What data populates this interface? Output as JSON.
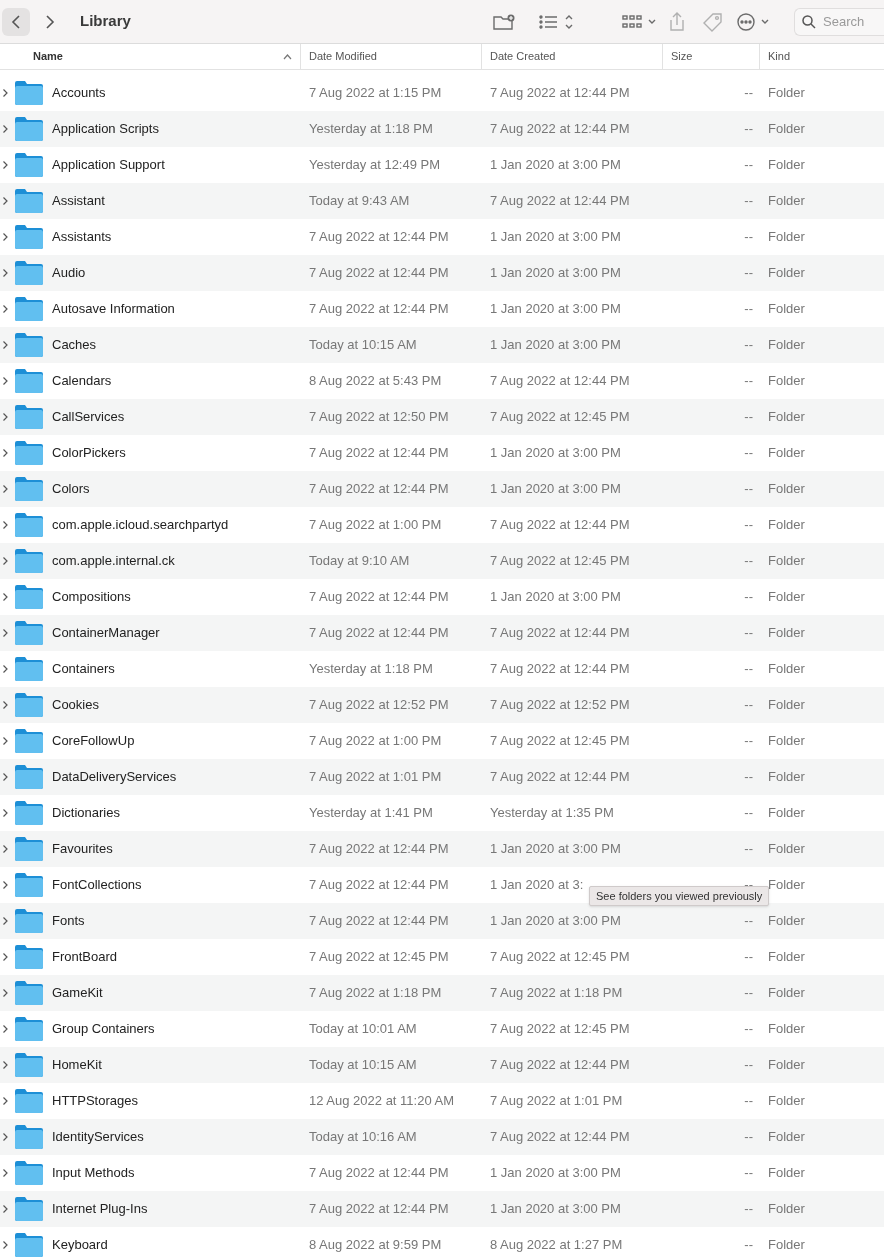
{
  "toolbar": {
    "title": "Library",
    "search": {
      "placeholder": "Search"
    }
  },
  "table": {
    "columns": [
      {
        "label": "Name",
        "sorted": true
      },
      {
        "label": "Date Modified",
        "sorted": false
      },
      {
        "label": "Date Created",
        "sorted": false
      },
      {
        "label": "Size",
        "sorted": false
      },
      {
        "label": "Kind",
        "sorted": false
      }
    ],
    "rows": [
      [
        "Accounts",
        "7 Aug 2022 at 1:15 PM",
        "7 Aug 2022 at 12:44 PM",
        "--",
        "Folder"
      ],
      [
        "Application Scripts",
        "Yesterday at 1:18 PM",
        "7 Aug 2022 at 12:44 PM",
        "--",
        "Folder"
      ],
      [
        "Application Support",
        "Yesterday at 12:49 PM",
        "1 Jan 2020 at 3:00 PM",
        "--",
        "Folder"
      ],
      [
        "Assistant",
        "Today at 9:43 AM",
        "7 Aug 2022 at 12:44 PM",
        "--",
        "Folder"
      ],
      [
        "Assistants",
        "7 Aug 2022 at 12:44 PM",
        "1 Jan 2020 at 3:00 PM",
        "--",
        "Folder"
      ],
      [
        "Audio",
        "7 Aug 2022 at 12:44 PM",
        "1 Jan 2020 at 3:00 PM",
        "--",
        "Folder"
      ],
      [
        "Autosave Information",
        "7 Aug 2022 at 12:44 PM",
        "1 Jan 2020 at 3:00 PM",
        "--",
        "Folder"
      ],
      [
        "Caches",
        "Today at 10:15 AM",
        "1 Jan 2020 at 3:00 PM",
        "--",
        "Folder"
      ],
      [
        "Calendars",
        "8 Aug 2022 at 5:43 PM",
        "7 Aug 2022 at 12:44 PM",
        "--",
        "Folder"
      ],
      [
        "CallServices",
        "7 Aug 2022 at 12:50 PM",
        "7 Aug 2022 at 12:45 PM",
        "--",
        "Folder"
      ],
      [
        "ColorPickers",
        "7 Aug 2022 at 12:44 PM",
        "1 Jan 2020 at 3:00 PM",
        "--",
        "Folder"
      ],
      [
        "Colors",
        "7 Aug 2022 at 12:44 PM",
        "1 Jan 2020 at 3:00 PM",
        "--",
        "Folder"
      ],
      [
        "com.apple.icloud.searchpartyd",
        "7 Aug 2022 at 1:00 PM",
        "7 Aug 2022 at 12:44 PM",
        "--",
        "Folder"
      ],
      [
        "com.apple.internal.ck",
        "Today at 9:10 AM",
        "7 Aug 2022 at 12:45 PM",
        "--",
        "Folder"
      ],
      [
        "Compositions",
        "7 Aug 2022 at 12:44 PM",
        "1 Jan 2020 at 3:00 PM",
        "--",
        "Folder"
      ],
      [
        "ContainerManager",
        "7 Aug 2022 at 12:44 PM",
        "7 Aug 2022 at 12:44 PM",
        "--",
        "Folder"
      ],
      [
        "Containers",
        "Yesterday at 1:18 PM",
        "7 Aug 2022 at 12:44 PM",
        "--",
        "Folder"
      ],
      [
        "Cookies",
        "7 Aug 2022 at 12:52 PM",
        "7 Aug 2022 at 12:52 PM",
        "--",
        "Folder"
      ],
      [
        "CoreFollowUp",
        "7 Aug 2022 at 1:00 PM",
        "7 Aug 2022 at 12:45 PM",
        "--",
        "Folder"
      ],
      [
        "DataDeliveryServices",
        "7 Aug 2022 at 1:01 PM",
        "7 Aug 2022 at 12:44 PM",
        "--",
        "Folder"
      ],
      [
        "Dictionaries",
        "Yesterday at 1:41 PM",
        "Yesterday at 1:35 PM",
        "--",
        "Folder"
      ],
      [
        "Favourites",
        "7 Aug 2022 at 12:44 PM",
        "1 Jan 2020 at 3:00 PM",
        "--",
        "Folder"
      ],
      [
        "FontCollections",
        "7 Aug 2022 at 12:44 PM",
        "1 Jan 2020 at 3:",
        "--",
        "Folder"
      ],
      [
        "Fonts",
        "7 Aug 2022 at 12:44 PM",
        "1 Jan 2020 at 3:00 PM",
        "--",
        "Folder"
      ],
      [
        "FrontBoard",
        "7 Aug 2022 at 12:45 PM",
        "7 Aug 2022 at 12:45 PM",
        "--",
        "Folder"
      ],
      [
        "GameKit",
        "7 Aug 2022 at 1:18 PM",
        "7 Aug 2022 at 1:18 PM",
        "--",
        "Folder"
      ],
      [
        "Group Containers",
        "Today at 10:01 AM",
        "7 Aug 2022 at 12:45 PM",
        "--",
        "Folder"
      ],
      [
        "HomeKit",
        "Today at 10:15 AM",
        "7 Aug 2022 at 12:44 PM",
        "--",
        "Folder"
      ],
      [
        "HTTPStorages",
        "12 Aug 2022 at 11:20 AM",
        "7 Aug 2022 at 1:01 PM",
        "--",
        "Folder"
      ],
      [
        "IdentityServices",
        "Today at 10:16 AM",
        "7 Aug 2022 at 12:44 PM",
        "--",
        "Folder"
      ],
      [
        "Input Methods",
        "7 Aug 2022 at 12:44 PM",
        "1 Jan 2020 at 3:00 PM",
        "--",
        "Folder"
      ],
      [
        "Internet Plug-Ins",
        "7 Aug 2022 at 12:44 PM",
        "1 Jan 2020 at 3:00 PM",
        "--",
        "Folder"
      ],
      [
        "Keyboard",
        "8 Aug 2022 at 9:59 PM",
        "8 Aug 2022 at 1:27 PM",
        "--",
        "Folder"
      ]
    ]
  },
  "tooltip": {
    "text": "See folders you viewed previously"
  }
}
